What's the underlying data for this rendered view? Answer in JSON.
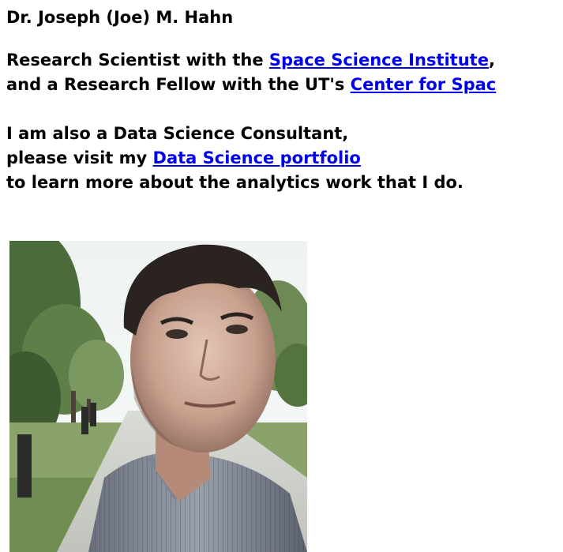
{
  "page": {
    "title": "Dr. Joseph (Joe) M. Hahn"
  },
  "intro": {
    "line1_prefix": "Research Scientist with the ",
    "line1_link": "Space Science Institute",
    "line1_suffix": ",",
    "line2_prefix": "and a Research Fellow with the UT's ",
    "line2_link": "Center for Spac"
  },
  "consult": {
    "line1": "I am also a Data Science Consultant,",
    "line2_prefix": "please visit my ",
    "line2_link": "Data Science portfolio",
    "line3": "to learn more about the analytics work that I do."
  },
  "colors": {
    "link": "#0000ee",
    "text": "#000000",
    "background": "#ffffff"
  }
}
